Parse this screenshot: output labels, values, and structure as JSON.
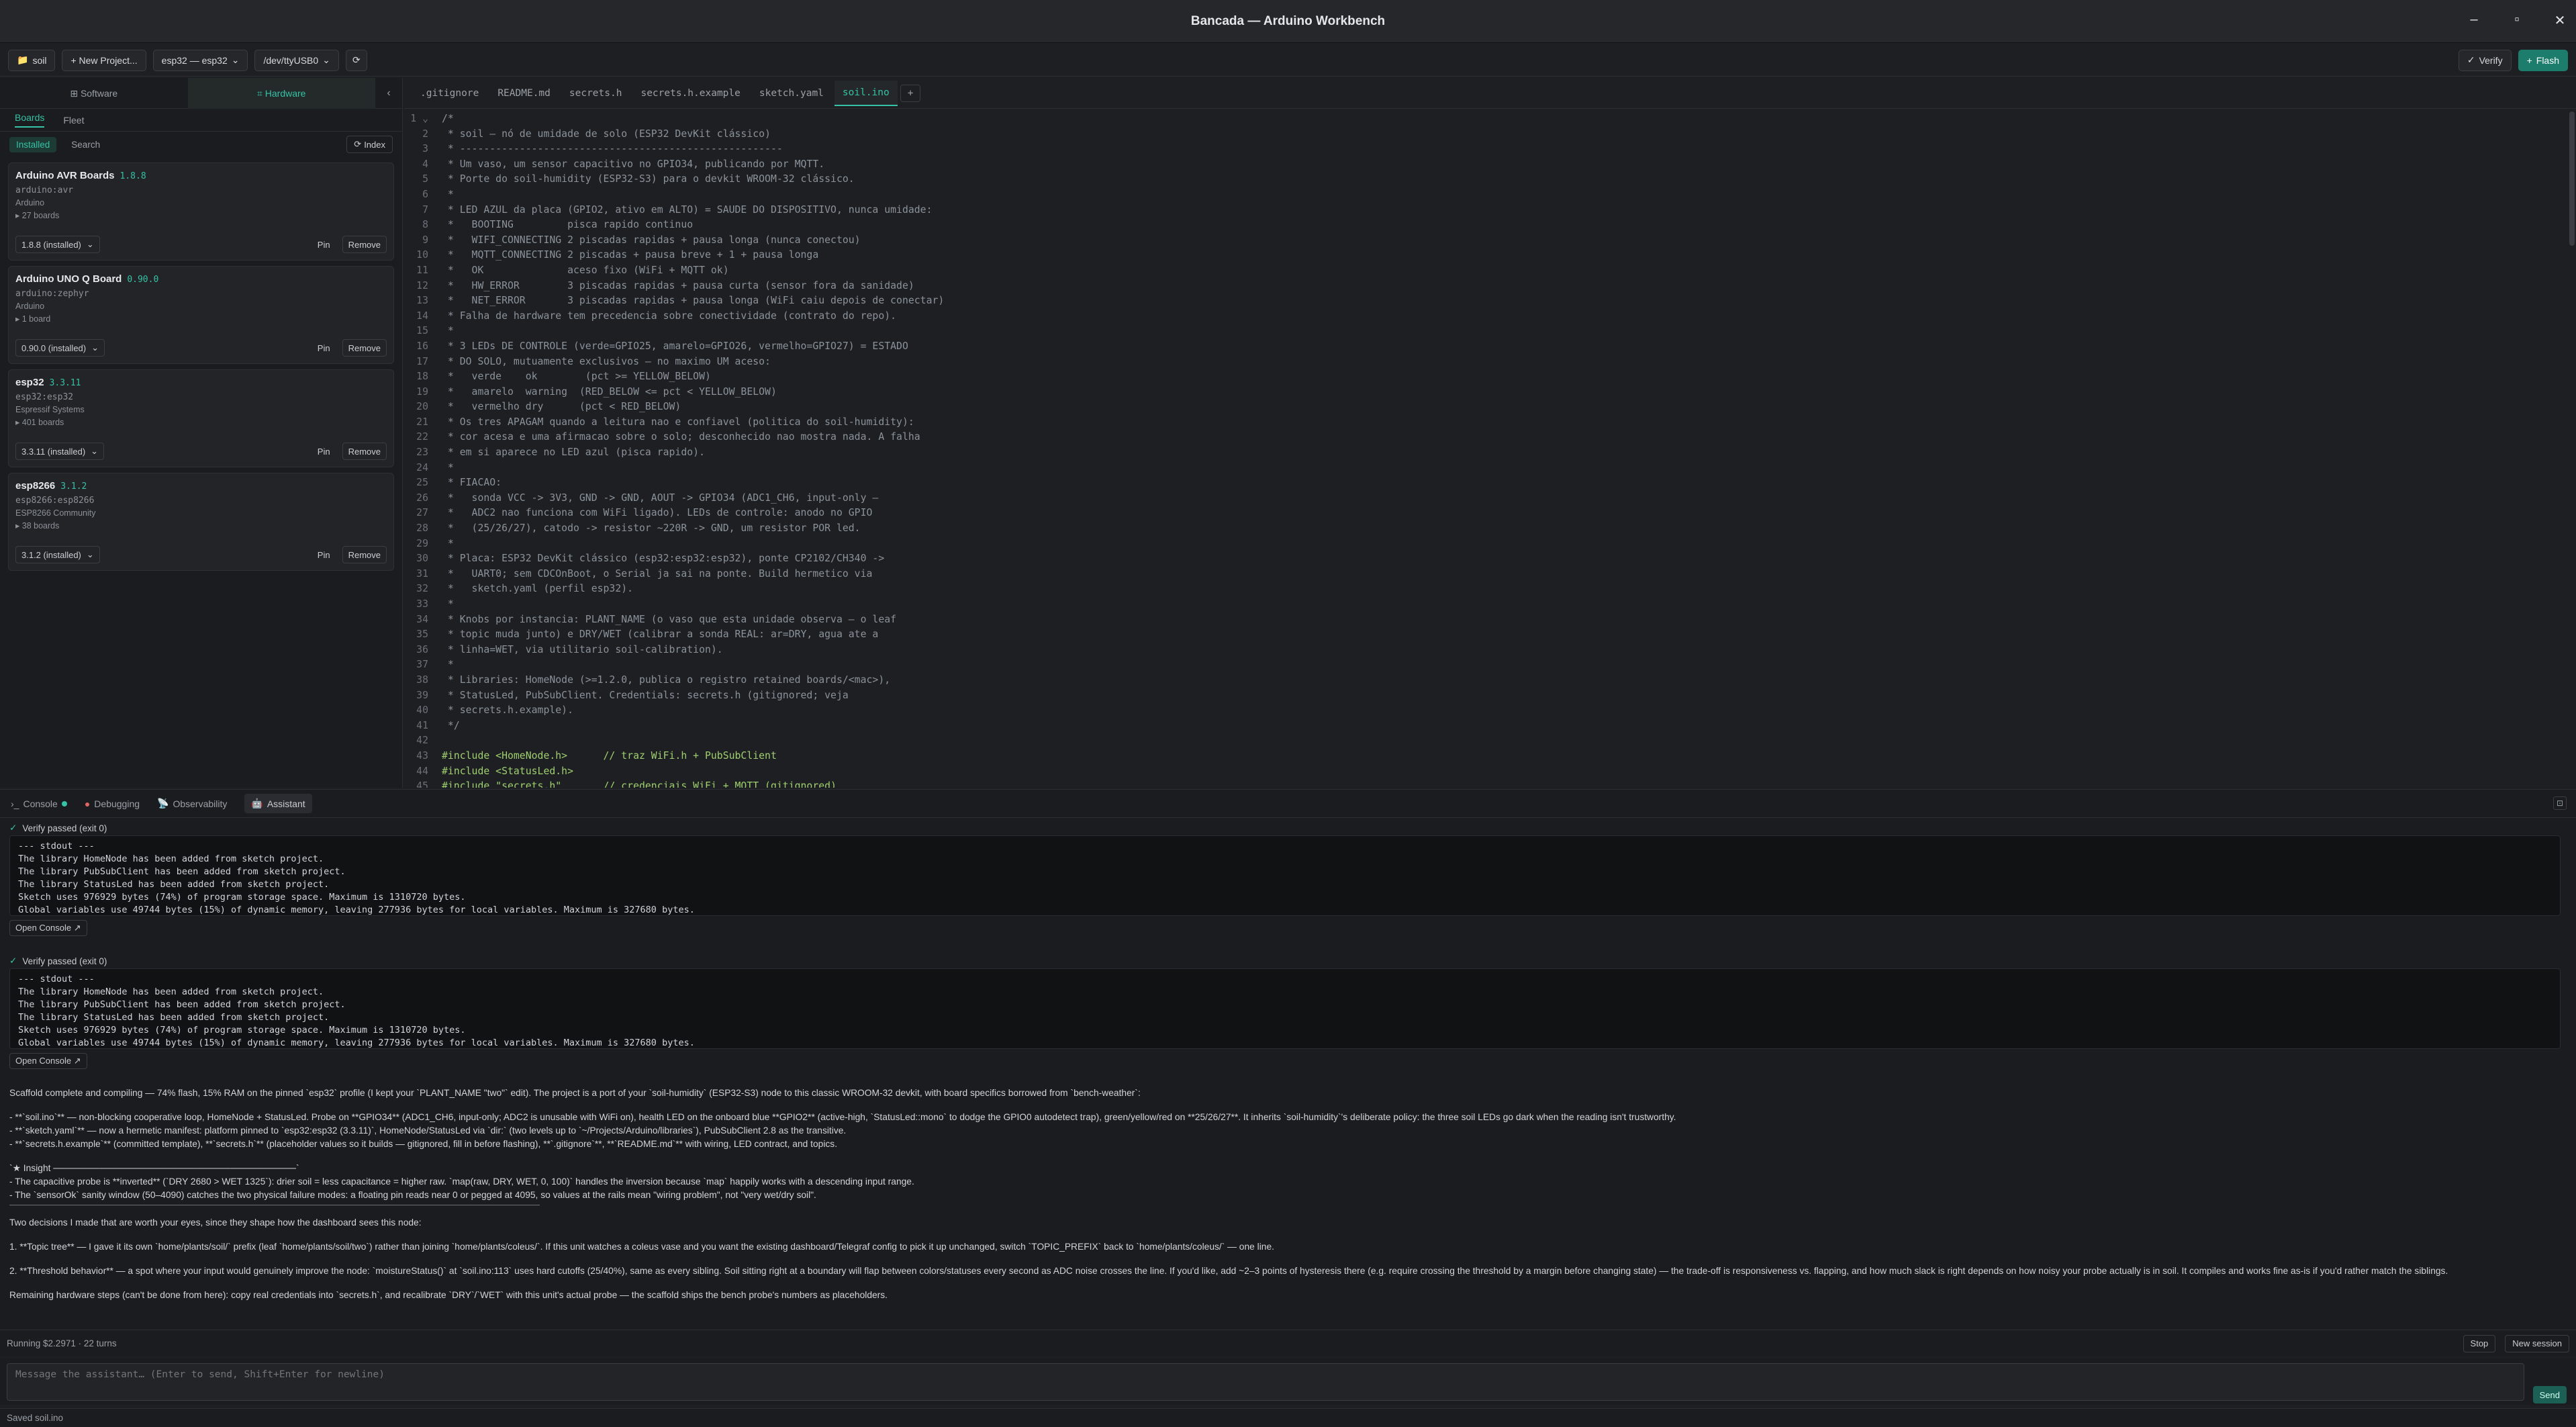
{
  "window": {
    "title": "Bancada — Arduino Workbench",
    "controls": [
      "–",
      "▫",
      "✕"
    ]
  },
  "toolbar": {
    "project": "soil",
    "new_project": "+ New Project...",
    "board": "esp32 — esp32",
    "port": "/dev/ttyUSB0",
    "verify": "Verify",
    "flash": "Flash"
  },
  "sidebar": {
    "segments": [
      "Software",
      "Hardware"
    ],
    "tabs": [
      "Boards",
      "Fleet"
    ],
    "subtabs": [
      "Installed",
      "Search"
    ],
    "index": "Index",
    "boards": [
      {
        "name": "Arduino AVR Boards",
        "version": "1.8.8",
        "id": "arduino:avr",
        "maintainer": "Arduino",
        "count": "27 boards",
        "selected": "1.8.8 (installed)",
        "pin": "Pin",
        "remove": "Remove"
      },
      {
        "name": "Arduino UNO Q Board",
        "version": "0.90.0",
        "id": "arduino:zephyr",
        "maintainer": "Arduino",
        "count": "1 board",
        "selected": "0.90.0 (installed)",
        "pin": "Pin",
        "remove": "Remove"
      },
      {
        "name": "esp32",
        "version": "3.3.11",
        "id": "esp32:esp32",
        "maintainer": "Espressif Systems",
        "count": "401 boards",
        "selected": "3.3.11 (installed)",
        "pin": "Pin",
        "remove": "Remove"
      },
      {
        "name": "esp8266",
        "version": "3.1.2",
        "id": "esp8266:esp8266",
        "maintainer": "ESP8266 Community",
        "count": "38 boards",
        "selected": "3.1.2 (installed)",
        "pin": "Pin",
        "remove": "Remove"
      }
    ]
  },
  "editor": {
    "tabs": [
      ".gitignore",
      "README.md",
      "secrets.h",
      "secrets.h.example",
      "sketch.yaml",
      "soil.ino"
    ],
    "active_tab": "soil.ino",
    "lines": [
      "/*",
      " * soil — nó de umidade de solo (ESP32 DevKit clássico)",
      " * ------------------------------------------------------",
      " * Um vaso, um sensor capacitivo no GPIO34, publicando por MQTT.",
      " * Porte do soil-humidity (ESP32-S3) para o devkit WROOM-32 clássico.",
      " *",
      " * LED AZUL da placa (GPIO2, ativo em ALTO) = SAUDE DO DISPOSITIVO, nunca umidade:",
      " *   BOOTING         pisca rapido continuo",
      " *   WIFI_CONNECTING 2 piscadas rapidas + pausa longa (nunca conectou)",
      " *   MQTT_CONNECTING 2 piscadas + pausa breve + 1 + pausa longa",
      " *   OK              aceso fixo (WiFi + MQTT ok)",
      " *   HW_ERROR        3 piscadas rapidas + pausa curta (sensor fora da sanidade)",
      " *   NET_ERROR       3 piscadas rapidas + pausa longa (WiFi caiu depois de conectar)",
      " * Falha de hardware tem precedencia sobre conectividade (contrato do repo).",
      " *",
      " * 3 LEDs DE CONTROLE (verde=GPIO25, amarelo=GPIO26, vermelho=GPIO27) = ESTADO",
      " * DO SOLO, mutuamente exclusivos — no maximo UM aceso:",
      " *   verde    ok        (pct >= YELLOW_BELOW)",
      " *   amarelo  warning  (RED_BELOW <= pct < YELLOW_BELOW)",
      " *   vermelho dry      (pct < RED_BELOW)",
      " * Os tres APAGAM quando a leitura nao e confiavel (politica do soil-humidity):",
      " * cor acesa e uma afirmacao sobre o solo; desconhecido nao mostra nada. A falha",
      " * em si aparece no LED azul (pisca rapido).",
      " *",
      " * FIACAO:",
      " *   sonda VCC -> 3V3, GND -> GND, AOUT -> GPIO34 (ADC1_CH6, input-only —",
      " *   ADC2 nao funciona com WiFi ligado). LEDs de controle: anodo no GPIO",
      " *   (25/26/27), catodo -> resistor ~220R -> GND, um resistor POR led.",
      " *",
      " * Placa: ESP32 DevKit clássico (esp32:esp32:esp32), ponte CP2102/CH340 ->",
      " *   UART0; sem CDCOnBoot, o Serial ja sai na ponte. Build hermetico via",
      " *   sketch.yaml (perfil esp32).",
      " *",
      " * Knobs por instancia: PLANT_NAME (o vaso que esta unidade observa — o leaf",
      " * topic muda junto) e DRY/WET (calibrar a sonda REAL: ar=DRY, agua ate a",
      " * linha=WET, via utilitario soil-calibration).",
      " *",
      " * Libraries: HomeNode (>=1.2.0, publica o registro retained boards/<mac>),",
      " * StatusLed, PubSubClient. Credentials: secrets.h (gitignored; veja",
      " * secrets.h.example).",
      " */",
      "",
      "#include <HomeNode.h>      // traz WiFi.h + PubSubClient",
      "#include <StatusLed.h>",
      "#include \"secrets.h\"       // credenciais WiFi + MQTT (gitignored)"
    ]
  },
  "panel": {
    "tabs": [
      "Console",
      "Debugging",
      "Observability",
      "Assistant"
    ],
    "verify_runs": [
      {
        "status": "Verify passed (exit 0)",
        "output": "--- stdout ---\nThe library HomeNode has been added from sketch project.\nThe library PubSubClient has been added from sketch project.\nThe library StatusLed has been added from sketch project.\nSketch uses 976929 bytes (74%) of program storage space. Maximum is 1310720 bytes.\nGlobal variables use 49744 bytes (15%) of dynamic memory, leaving 277936 bytes for local variables. Maximum is 327680 bytes.",
        "open": "Open Console ↗"
      },
      {
        "status": "Verify passed (exit 0)",
        "output": "--- stdout ---\nThe library HomeNode has been added from sketch project.\nThe library PubSubClient has been added from sketch project.\nThe library StatusLed has been added from sketch project.\nSketch uses 976929 bytes (74%) of program storage space. Maximum is 1310720 bytes.\nGlobal variables use 49744 bytes (15%) of dynamic memory, leaving 277936 bytes for local variables. Maximum is 327680 bytes.",
        "open": "Open Console ↗"
      }
    ],
    "message": {
      "p1": "Scaffold complete and compiling — 74% flash, 15% RAM on the pinned `esp32` profile (I kept your `PLANT_NAME \"two\"` edit). The project is a port of your `soil-humidity` (ESP32-S3) node to this classic WROOM-32 devkit, with board specifics borrowed from `bench-weather`:",
      "bullets1": [
        "- **`soil.ino`** — non-blocking cooperative loop, HomeNode + StatusLed. Probe on **GPIO34** (ADC1_CH6, input-only; ADC2 is unusable with WiFi on), health LED on the onboard blue **GPIO2** (active-high, `StatusLed::mono` to dodge the GPIO0 autodetect trap), green/yellow/red on **25/26/27**. It inherits `soil-humidity`'s deliberate policy: the three soil LEDs go dark when the reading isn't trustworthy.",
        "- **`sketch.yaml`** — now a hermetic manifest: platform pinned to `esp32:esp32 (3.3.11)`, HomeNode/StatusLed via `dir:` (two levels up to `~/Projects/Arduino/libraries`), PubSubClient 2.8 as the transitive.",
        "- **`secrets.h.example`** (committed template), **`secrets.h`** (placeholder values so it builds — gitignored, fill in before flashing), **`.gitignore`**, **`README.md`** with wiring, LED contract, and topics."
      ],
      "insight_title": "`★ Insight ─────────────────────────────────────`",
      "insight": [
        "- The capacitive probe is **inverted** (`DRY 2680 > WET 1325`): drier soil = less capacitance = higher raw. `map(raw, DRY, WET, 0, 100)` handles the inversion because `map` happily works with a descending input range.",
        "- The `sensorOk` sanity window (50–4090) catches the two physical failure modes: a floating pin reads near 0 or pegged at 4095, so values at the rails mean \"wiring problem\", not \"very wet/dry soil\"."
      ],
      "p2": "Two decisions I made that are worth your eyes, since they shape how the dashboard sees this node:",
      "p3": "1. **Topic tree** — I gave it its own `home/plants/soil/` prefix (leaf `home/plants/soil/two`) rather than joining `home/plants/coleus/`. If this unit watches a coleus vase and you want the existing dashboard/Telegraf config to pick it up unchanged, switch `TOPIC_PREFIX` back to `home/plants/coleus/` — one line.",
      "p4": "2. **Threshold behavior** — a spot where your input would genuinely improve the node: `moistureStatus()` at `soil.ino:113` uses hard cutoffs (25/40%), same as every sibling. Soil sitting right at a boundary will flap between colors/statuses every second as ADC noise crosses the line. If you'd like, add ~2–3 points of hysteresis there (e.g. require crossing the threshold by a margin before changing state) — the trade-off is responsiveness vs. flapping, and how much slack is right depends on how noisy your probe actually is in soil. It compiles and works fine as-is if you'd rather match the siblings.",
      "p5": "Remaining hardware steps (can't be done from here): copy real credentials into `secrets.h`, and recalibrate `DRY`/`WET` with this unit's actual probe — the scaffold ships the bench probe's numbers as placeholders."
    },
    "running": "Running  $2.2971  · 22 turns",
    "stop": "Stop",
    "new_session": "New session",
    "composer_placeholder": "Message the assistant… (Enter to send, Shift+Enter for newline)",
    "send": "Send"
  },
  "statusbar": {
    "text": "Saved soil.ino"
  },
  "colors": {
    "accent": "#35c2a6",
    "flash_bg": "#1c7d6c"
  }
}
